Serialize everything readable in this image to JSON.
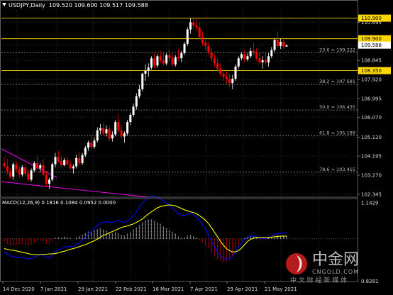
{
  "header": {
    "symbol_period": "USDJPY,Daily",
    "ohlc": "109.520 109.600 109.517 109.588"
  },
  "macd_label": "MACD(12,26,9) 0.1816 0.1084 0.0952 0.0000",
  "price_axis": {
    "ticks": [
      "110.695",
      "109.900",
      "109.588",
      "108.845",
      "108.350",
      "107.920",
      "106.995",
      "106.070",
      "105.120",
      "104.195",
      "103.270",
      "102.345"
    ],
    "hline_labels": [
      "110.900",
      "109.900",
      "108.350"
    ],
    "current_price": "109.588"
  },
  "macd_axis": {
    "ticks": [
      "1.1429",
      "0.8281"
    ]
  },
  "date_axis": {
    "labels": [
      "14 Dec 2020",
      "7 Jan 2021",
      "29 Jan 2021",
      "22 Feb 2021",
      "16 Mar 2021",
      "7 Apr 2021",
      "29 Apr 2021",
      "21 May 2021"
    ]
  },
  "fib_levels": [
    {
      "label": "23.6 = 109.222",
      "value": 109.222
    },
    {
      "label": "38.2 = 107.681",
      "value": 107.681
    },
    {
      "label": "50.0 = 106.435",
      "value": 106.435
    },
    {
      "label": "61.8 = 105.189",
      "value": 105.189
    },
    {
      "label": "78.6 = 103.415",
      "value": 103.415
    }
  ],
  "watermark": {
    "brand": "中金网",
    "url": "CNGOLD.COM",
    "tagline": "中 文 财 经 新 媒 体"
  },
  "colors": {
    "background": "#000000",
    "bull": "#ffffff",
    "bear": "#ff0000",
    "hline": "#ffd700",
    "macd_signal": "#ffff00",
    "macd_line": "#0000ff",
    "trendline": "#ff00ff",
    "fib": "#9a9a9a"
  },
  "chart_data": {
    "type": "candlestick",
    "symbol": "USDJPY",
    "period": "Daily",
    "y_range": [
      102.2,
      111.3
    ],
    "horizontal_levels": [
      110.9,
      109.9,
      108.35
    ],
    "ohlc_daily_approx": [
      [
        103.85,
        104.15,
        103.6,
        103.7
      ],
      [
        103.7,
        104.05,
        103.3,
        103.45
      ],
      [
        103.45,
        103.6,
        103.1,
        103.2
      ],
      [
        103.2,
        103.9,
        103.05,
        103.8
      ],
      [
        103.8,
        103.95,
        103.4,
        103.55
      ],
      [
        103.55,
        103.7,
        103.15,
        103.3
      ],
      [
        103.3,
        103.75,
        103.2,
        103.65
      ],
      [
        103.65,
        103.8,
        103.25,
        103.35
      ],
      [
        103.35,
        103.55,
        102.95,
        103.05
      ],
      [
        103.05,
        103.6,
        102.95,
        103.5
      ],
      [
        103.5,
        103.95,
        103.4,
        103.85
      ],
      [
        103.85,
        104.2,
        103.55,
        103.6
      ],
      [
        103.6,
        103.85,
        103.4,
        103.75
      ],
      [
        103.75,
        104.05,
        103.25,
        103.3
      ],
      [
        103.3,
        103.45,
        102.7,
        102.85
      ],
      [
        102.85,
        103.15,
        102.6,
        103.05
      ],
      [
        103.05,
        103.9,
        102.95,
        103.8
      ],
      [
        103.8,
        104.35,
        103.65,
        104.15
      ],
      [
        104.15,
        104.45,
        103.85,
        103.95
      ],
      [
        103.95,
        104.2,
        103.65,
        103.75
      ],
      [
        103.75,
        104.1,
        103.7,
        104.0
      ],
      [
        104.0,
        104.15,
        103.75,
        103.8
      ],
      [
        103.8,
        103.95,
        103.55,
        103.6
      ],
      [
        103.6,
        103.8,
        103.35,
        103.7
      ],
      [
        103.7,
        104.25,
        103.6,
        104.1
      ],
      [
        104.1,
        104.4,
        103.75,
        103.85
      ],
      [
        103.85,
        104.35,
        103.75,
        104.25
      ],
      [
        104.25,
        104.7,
        104.15,
        104.6
      ],
      [
        104.6,
        104.95,
        104.45,
        104.85
      ],
      [
        104.85,
        105.2,
        104.55,
        104.65
      ],
      [
        104.65,
        105.1,
        104.55,
        104.95
      ],
      [
        104.95,
        105.6,
        104.85,
        105.45
      ],
      [
        105.45,
        105.75,
        105.25,
        105.55
      ],
      [
        105.55,
        105.8,
        105.2,
        105.3
      ],
      [
        105.3,
        105.7,
        105.15,
        105.5
      ],
      [
        105.5,
        105.65,
        104.95,
        105.05
      ],
      [
        105.05,
        105.4,
        104.9,
        105.25
      ],
      [
        105.25,
        105.95,
        105.15,
        105.85
      ],
      [
        105.85,
        106.2,
        105.35,
        105.45
      ],
      [
        105.45,
        105.7,
        105.05,
        105.15
      ],
      [
        105.15,
        105.4,
        104.85,
        105.3
      ],
      [
        105.3,
        105.95,
        105.2,
        105.85
      ],
      [
        105.85,
        106.3,
        105.7,
        106.2
      ],
      [
        106.2,
        106.75,
        106.1,
        106.6
      ],
      [
        106.6,
        107.25,
        106.45,
        107.1
      ],
      [
        107.1,
        107.65,
        107.0,
        107.45
      ],
      [
        107.45,
        108.25,
        107.35,
        108.2
      ],
      [
        108.2,
        108.65,
        107.85,
        108.35
      ],
      [
        108.35,
        108.7,
        108.05,
        108.5
      ],
      [
        108.5,
        109.05,
        108.4,
        108.95
      ],
      [
        108.95,
        109.2,
        108.45,
        108.6
      ],
      [
        108.6,
        109.15,
        108.5,
        109.05
      ],
      [
        109.05,
        109.3,
        108.7,
        108.85
      ],
      [
        108.85,
        109.25,
        108.6,
        108.7
      ],
      [
        108.7,
        109.2,
        108.6,
        109.1
      ],
      [
        109.1,
        109.35,
        108.8,
        108.95
      ],
      [
        108.95,
        109.15,
        108.55,
        108.65
      ],
      [
        108.65,
        109.1,
        108.55,
        109.0
      ],
      [
        109.0,
        109.4,
        108.85,
        108.95
      ],
      [
        108.95,
        109.3,
        108.75,
        109.2
      ],
      [
        109.2,
        109.75,
        109.1,
        109.65
      ],
      [
        109.65,
        110.45,
        109.55,
        110.35
      ],
      [
        110.35,
        110.9,
        110.15,
        110.7
      ],
      [
        110.7,
        110.95,
        110.35,
        110.55
      ],
      [
        110.55,
        110.85,
        110.25,
        110.45
      ],
      [
        110.45,
        110.7,
        109.9,
        110.0
      ],
      [
        110.0,
        110.25,
        109.55,
        109.7
      ],
      [
        109.7,
        109.95,
        109.35,
        109.55
      ],
      [
        109.55,
        109.75,
        109.1,
        109.25
      ],
      [
        109.25,
        109.45,
        108.8,
        108.95
      ],
      [
        108.95,
        109.15,
        108.55,
        108.7
      ],
      [
        108.7,
        108.95,
        108.3,
        108.45
      ],
      [
        108.45,
        108.7,
        108.05,
        108.2
      ],
      [
        108.2,
        108.45,
        107.85,
        108.05
      ],
      [
        108.05,
        108.3,
        107.7,
        107.95
      ],
      [
        107.95,
        108.2,
        107.55,
        107.75
      ],
      [
        107.75,
        108.15,
        107.45,
        107.95
      ],
      [
        107.95,
        108.65,
        107.85,
        108.55
      ],
      [
        108.55,
        109.05,
        108.45,
        108.95
      ],
      [
        108.95,
        109.25,
        108.85,
        109.15
      ],
      [
        109.15,
        109.35,
        108.75,
        108.9
      ],
      [
        108.9,
        109.2,
        108.8,
        109.05
      ],
      [
        109.05,
        109.45,
        108.95,
        109.3
      ],
      [
        109.3,
        109.7,
        109.1,
        109.25
      ],
      [
        109.25,
        109.45,
        108.85,
        108.95
      ],
      [
        108.95,
        109.25,
        108.65,
        108.75
      ],
      [
        108.75,
        109.05,
        108.45,
        108.85
      ],
      [
        108.85,
        109.2,
        108.65,
        108.75
      ],
      [
        108.75,
        109.2,
        108.55,
        109.05
      ],
      [
        109.05,
        109.5,
        108.95,
        109.35
      ],
      [
        109.35,
        109.9,
        109.25,
        109.85
      ],
      [
        109.85,
        110.25,
        109.5,
        109.55
      ],
      [
        109.55,
        109.9,
        109.4,
        109.75
      ],
      [
        109.75,
        109.85,
        109.4,
        109.52
      ],
      [
        109.52,
        109.6,
        109.51,
        109.588
      ]
    ],
    "macd": {
      "label": "MACD(12,26,9)",
      "y_range": [
        -1.3,
        1.2
      ],
      "histogram_approx": [
        -0.1,
        -0.15,
        -0.2,
        -0.22,
        -0.2,
        -0.18,
        -0.15,
        -0.18,
        -0.22,
        -0.18,
        -0.12,
        -0.08,
        -0.05,
        -0.08,
        -0.15,
        -0.18,
        -0.1,
        0.02,
        0.05,
        0.04,
        0.06,
        0.05,
        0.02,
        0.0,
        0.05,
        0.07,
        0.12,
        0.18,
        0.22,
        0.22,
        0.24,
        0.3,
        0.32,
        0.28,
        0.26,
        0.2,
        0.18,
        0.22,
        0.18,
        0.12,
        0.1,
        0.15,
        0.2,
        0.28,
        0.35,
        0.42,
        0.5,
        0.55,
        0.58,
        0.6,
        0.55,
        0.5,
        0.45,
        0.38,
        0.32,
        0.26,
        0.2,
        0.15,
        0.08,
        0.04,
        0.05,
        0.1,
        0.12,
        0.08,
        0.02,
        -0.05,
        -0.12,
        -0.2,
        -0.3,
        -0.42,
        -0.55,
        -0.62,
        -0.68,
        -0.72,
        -0.7,
        -0.65,
        -0.52,
        -0.35,
        -0.2,
        -0.08,
        0.02,
        0.06,
        0.08,
        0.06,
        0.02,
        -0.02,
        -0.04,
        -0.03,
        0.02,
        0.06,
        0.1,
        0.1,
        0.09,
        0.095,
        0.095
      ],
      "macd_line_approx": [
        -0.4,
        -0.46,
        -0.52,
        -0.55,
        -0.56,
        -0.57,
        -0.56,
        -0.58,
        -0.62,
        -0.6,
        -0.56,
        -0.52,
        -0.48,
        -0.5,
        -0.56,
        -0.58,
        -0.5,
        -0.4,
        -0.33,
        -0.3,
        -0.26,
        -0.24,
        -0.24,
        -0.24,
        -0.18,
        -0.12,
        -0.04,
        0.06,
        0.15,
        0.22,
        0.3,
        0.4,
        0.48,
        0.5,
        0.52,
        0.5,
        0.5,
        0.54,
        0.55,
        0.52,
        0.5,
        0.54,
        0.6,
        0.7,
        0.82,
        0.95,
        1.08,
        1.18,
        1.25,
        1.3,
        1.28,
        1.25,
        1.22,
        1.15,
        1.08,
        1.0,
        0.92,
        0.85,
        0.76,
        0.7,
        0.7,
        0.75,
        0.78,
        0.74,
        0.66,
        0.55,
        0.42,
        0.28,
        0.12,
        -0.06,
        -0.25,
        -0.4,
        -0.52,
        -0.6,
        -0.62,
        -0.62,
        -0.54,
        -0.4,
        -0.26,
        -0.12,
        -0.02,
        0.04,
        0.08,
        0.08,
        0.06,
        0.02,
        0.0,
        0.0,
        0.04,
        0.08,
        0.14,
        0.16,
        0.17,
        0.18,
        0.18
      ],
      "signal_approx": [
        -0.3,
        -0.32,
        -0.34,
        -0.35,
        -0.37,
        -0.39,
        -0.41,
        -0.43,
        -0.45,
        -0.47,
        -0.48,
        -0.48,
        -0.48,
        -0.47,
        -0.47,
        -0.46,
        -0.46,
        -0.45,
        -0.43,
        -0.4,
        -0.38,
        -0.35,
        -0.32,
        -0.3,
        -0.27,
        -0.24,
        -0.21,
        -0.18,
        -0.14,
        -0.1,
        -0.06,
        -0.01,
        0.05,
        0.1,
        0.14,
        0.18,
        0.22,
        0.26,
        0.3,
        0.34,
        0.37,
        0.39,
        0.42,
        0.45,
        0.5,
        0.55,
        0.6,
        0.68,
        0.75,
        0.82,
        0.88,
        0.94,
        0.98,
        1.0,
        1.02,
        1.03,
        1.02,
        1.0,
        0.96,
        0.92,
        0.88,
        0.85,
        0.82,
        0.8,
        0.76,
        0.7,
        0.64,
        0.56,
        0.46,
        0.34,
        0.2,
        0.06,
        -0.08,
        -0.2,
        -0.3,
        -0.36,
        -0.4,
        -0.4,
        -0.36,
        -0.28,
        -0.18,
        -0.08,
        -0.02,
        0.02,
        0.04,
        0.04,
        0.04,
        0.04,
        0.04,
        0.05,
        0.06,
        0.07,
        0.08,
        0.08,
        0.08
      ]
    }
  }
}
